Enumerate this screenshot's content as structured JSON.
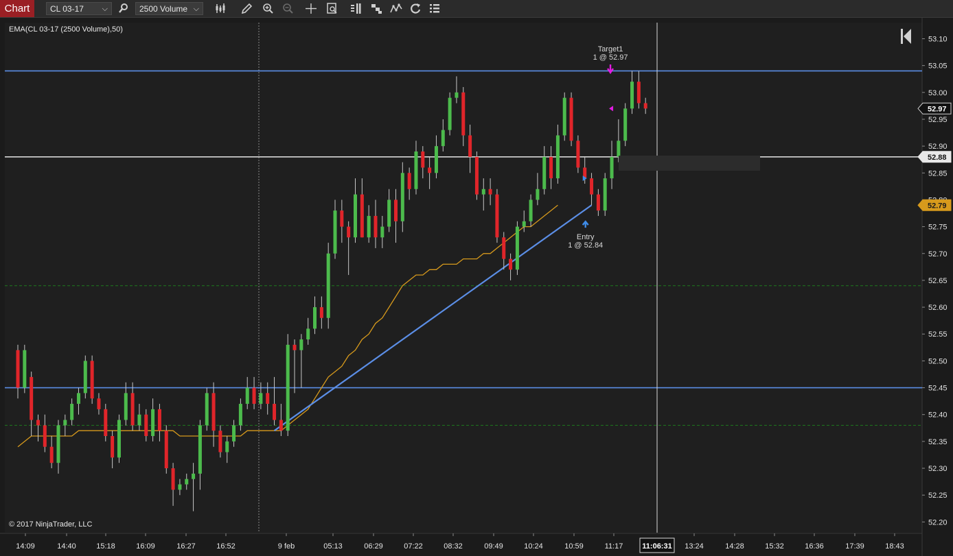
{
  "toolbar": {
    "tab_label": "Chart",
    "instrument": "CL 03-17",
    "interval": "2500 Volume",
    "icons": [
      "search-icon",
      "bars-type-icon",
      "pencil-icon",
      "zoom-in-icon",
      "zoom-out-icon",
      "crosshair-icon",
      "data-box-icon",
      "chart-trader-icon",
      "strategies-icon",
      "indicators-icon",
      "refresh-icon",
      "properties-icon"
    ]
  },
  "indicator_label": "EMA(CL 03-17 (2500 Volume),50)",
  "copyright": "© 2017 NinjaTrader, LLC",
  "price_axis": {
    "ticks": [
      "53.10",
      "53.05",
      "53.00",
      "52.95",
      "52.90",
      "52.85",
      "52.80",
      "52.75",
      "52.70",
      "52.65",
      "52.60",
      "52.55",
      "52.50",
      "52.45",
      "52.40",
      "52.35",
      "52.30",
      "52.25",
      "52.20"
    ],
    "markers": [
      {
        "label": "52.97",
        "price": 52.97,
        "style": "last"
      },
      {
        "label": "52.88",
        "price": 52.88,
        "style": "cursor"
      },
      {
        "label": "52.79",
        "price": 52.79,
        "style": "ema"
      }
    ]
  },
  "time_axis": {
    "ticks": [
      "14:09",
      "14:40",
      "15:18",
      "16:09",
      "16:27",
      "16:52",
      "9 feb",
      "05:13",
      "06:29",
      "07:22",
      "08:32",
      "09:49",
      "10:24",
      "10:59",
      "11:17",
      "13:24",
      "14:28",
      "15:32",
      "16:36",
      "17:39",
      "18:43"
    ],
    "cursor_label": "11:06:31"
  },
  "chart_data": {
    "type": "candlestick",
    "instrument": "CL 03-17",
    "interval": "2500 Volume",
    "indicator": "EMA(CL 03-17 (2500 Volume),50)",
    "ylim": [
      52.18,
      53.13
    ],
    "candles": [
      [
        52.52,
        52.45,
        52.53,
        52.43
      ],
      [
        52.45,
        52.52,
        52.53,
        52.44
      ],
      [
        52.47,
        52.39,
        52.48,
        52.36
      ],
      [
        52.39,
        52.38,
        52.4,
        52.35
      ],
      [
        52.38,
        52.34,
        52.4,
        52.33
      ],
      [
        52.34,
        52.31,
        52.36,
        52.3
      ],
      [
        52.31,
        52.38,
        52.39,
        52.29
      ],
      [
        52.38,
        52.39,
        52.4,
        52.36
      ],
      [
        52.39,
        52.42,
        52.43,
        52.38
      ],
      [
        52.42,
        52.44,
        52.45,
        52.4
      ],
      [
        52.44,
        52.5,
        52.51,
        52.43
      ],
      [
        52.5,
        52.43,
        52.51,
        52.42
      ],
      [
        52.43,
        52.41,
        52.44,
        52.4
      ],
      [
        52.41,
        52.36,
        52.42,
        52.35
      ],
      [
        52.36,
        52.32,
        52.37,
        52.3
      ],
      [
        52.32,
        52.39,
        52.4,
        52.31
      ],
      [
        52.39,
        52.44,
        52.46,
        52.38
      ],
      [
        52.44,
        52.38,
        52.46,
        52.37
      ],
      [
        52.38,
        52.4,
        52.42,
        52.37
      ],
      [
        52.4,
        52.36,
        52.41,
        52.35
      ],
      [
        52.36,
        52.41,
        52.43,
        52.35
      ],
      [
        52.41,
        52.37,
        52.42,
        52.35
      ],
      [
        52.37,
        52.3,
        52.38,
        52.29
      ],
      [
        52.3,
        52.26,
        52.31,
        52.23
      ],
      [
        52.26,
        52.27,
        52.28,
        52.25
      ],
      [
        52.27,
        52.28,
        52.29,
        52.26
      ],
      [
        52.28,
        52.29,
        52.31,
        52.22
      ],
      [
        52.29,
        52.38,
        52.39,
        52.26
      ],
      [
        52.38,
        52.44,
        52.45,
        52.37
      ],
      [
        52.44,
        52.37,
        52.46,
        52.34
      ],
      [
        52.37,
        52.33,
        52.38,
        52.32
      ],
      [
        52.33,
        52.35,
        52.36,
        52.31
      ],
      [
        52.35,
        52.38,
        52.39,
        52.34
      ],
      [
        52.38,
        52.42,
        52.43,
        52.37
      ],
      [
        52.42,
        52.45,
        52.47,
        52.41
      ],
      [
        52.45,
        52.42,
        52.47,
        52.41
      ],
      [
        52.42,
        52.44,
        52.46,
        52.41
      ],
      [
        52.44,
        52.42,
        52.46,
        52.4
      ],
      [
        52.42,
        52.39,
        52.47,
        52.38
      ],
      [
        52.39,
        52.37,
        52.42,
        52.36
      ],
      [
        52.37,
        52.53,
        52.55,
        52.36
      ],
      [
        52.53,
        52.52,
        52.54,
        52.44
      ],
      [
        52.52,
        52.54,
        52.55,
        52.45
      ],
      [
        52.54,
        52.56,
        52.58,
        52.53
      ],
      [
        52.56,
        52.6,
        52.62,
        52.55
      ],
      [
        52.6,
        52.58,
        52.62,
        52.56
      ],
      [
        52.58,
        52.7,
        52.72,
        52.56
      ],
      [
        52.7,
        52.78,
        52.8,
        52.69
      ],
      [
        52.78,
        52.75,
        52.8,
        52.72
      ],
      [
        52.75,
        52.73,
        52.76,
        52.66
      ],
      [
        52.73,
        52.81,
        52.84,
        52.72
      ],
      [
        52.81,
        52.73,
        52.84,
        52.73
      ],
      [
        52.73,
        52.77,
        52.79,
        52.72
      ],
      [
        52.77,
        52.73,
        52.8,
        52.71
      ],
      [
        52.73,
        52.75,
        52.77,
        52.71
      ],
      [
        52.75,
        52.8,
        52.82,
        52.74
      ],
      [
        52.8,
        52.76,
        52.82,
        52.72
      ],
      [
        52.76,
        52.85,
        52.87,
        52.74
      ],
      [
        52.85,
        52.82,
        52.86,
        52.8
      ],
      [
        52.82,
        52.89,
        52.91,
        52.81
      ],
      [
        52.89,
        52.86,
        52.9,
        52.84
      ],
      [
        52.86,
        52.85,
        52.88,
        52.82
      ],
      [
        52.85,
        52.9,
        52.92,
        52.84
      ],
      [
        52.9,
        52.93,
        52.95,
        52.89
      ],
      [
        52.93,
        52.99,
        53.0,
        52.92
      ],
      [
        52.99,
        53.0,
        53.03,
        52.98
      ],
      [
        53.0,
        52.92,
        53.01,
        52.9
      ],
      [
        52.92,
        52.88,
        52.94,
        52.85
      ],
      [
        52.88,
        52.81,
        52.89,
        52.8
      ],
      [
        52.81,
        52.82,
        52.84,
        52.78
      ],
      [
        52.82,
        52.81,
        52.84,
        52.79
      ],
      [
        52.81,
        52.73,
        52.82,
        52.72
      ],
      [
        52.73,
        52.69,
        52.74,
        52.67
      ],
      [
        52.69,
        52.67,
        52.7,
        52.65
      ],
      [
        52.67,
        52.75,
        52.76,
        52.66
      ],
      [
        52.75,
        52.76,
        52.78,
        52.74
      ],
      [
        52.76,
        52.8,
        52.81,
        52.75
      ],
      [
        52.8,
        52.82,
        52.85,
        52.79
      ],
      [
        52.82,
        52.88,
        52.9,
        52.81
      ],
      [
        52.88,
        52.84,
        52.9,
        52.82
      ],
      [
        52.84,
        52.92,
        52.94,
        52.83
      ],
      [
        52.92,
        52.99,
        53.0,
        52.91
      ],
      [
        52.99,
        52.91,
        53.0,
        52.9
      ],
      [
        52.91,
        52.86,
        52.92,
        52.85
      ],
      [
        52.86,
        52.84,
        52.88,
        52.83
      ],
      [
        52.84,
        52.81,
        52.85,
        52.79
      ],
      [
        52.81,
        52.78,
        52.82,
        52.77
      ],
      [
        52.78,
        52.84,
        52.85,
        52.77
      ],
      [
        52.84,
        52.88,
        52.91,
        52.82
      ],
      [
        52.88,
        52.91,
        52.95,
        52.87
      ],
      [
        52.91,
        52.97,
        52.98,
        52.9
      ],
      [
        52.97,
        53.02,
        53.04,
        52.96
      ],
      [
        53.02,
        52.98,
        53.04,
        52.97
      ],
      [
        52.98,
        52.97,
        52.99,
        52.96
      ]
    ],
    "ema": [
      52.34,
      52.35,
      52.36,
      52.36,
      52.36,
      52.36,
      52.36,
      52.36,
      52.36,
      52.37,
      52.37,
      52.37,
      52.37,
      52.37,
      52.37,
      52.37,
      52.37,
      52.37,
      52.37,
      52.37,
      52.37,
      52.37,
      52.37,
      52.37,
      52.36,
      52.36,
      52.36,
      52.36,
      52.36,
      52.36,
      52.36,
      52.36,
      52.36,
      52.36,
      52.37,
      52.37,
      52.37,
      52.37,
      52.37,
      52.37,
      52.38,
      52.39,
      52.4,
      52.41,
      52.43,
      52.45,
      52.47,
      52.48,
      52.49,
      52.51,
      52.52,
      52.54,
      52.55,
      52.57,
      52.58,
      52.6,
      52.62,
      52.64,
      52.65,
      52.66,
      52.66,
      52.67,
      52.67,
      52.68,
      52.68,
      52.68,
      52.69,
      52.69,
      52.69,
      52.7,
      52.7,
      52.71,
      52.72,
      52.73,
      52.74,
      52.75,
      52.75,
      52.76,
      52.77,
      52.78,
      52.79
    ],
    "horizontal_lines": [
      {
        "price": 53.04,
        "color": "#5b8ee6",
        "style": "solid"
      },
      {
        "price": 52.45,
        "color": "#5b8ee6",
        "style": "solid"
      },
      {
        "price": 52.88,
        "color": "#d8d8d8",
        "style": "solid"
      },
      {
        "price": 52.64,
        "color": "#1f7a1f",
        "style": "dashed"
      },
      {
        "price": 52.38,
        "color": "#1f7a1f",
        "style": "dashed"
      }
    ],
    "trend_line": {
      "from_bar": 38,
      "from_price": 52.37,
      "to_bar": 85,
      "to_price": 52.79
    },
    "entry": {
      "title": "Entry",
      "detail": "1 @ 52.84",
      "bar": 84,
      "price": 52.84
    },
    "target": {
      "title": "Target1",
      "detail": "1 @ 52.97",
      "bar": 88,
      "price": 52.97
    },
    "colors": {
      "up": "#4cbb4c",
      "down": "#e0252a",
      "wick": "#c8c8c8",
      "ema": "#d79a1c",
      "grid": "#2a2a2a",
      "axis_text": "#e4e4e4"
    }
  }
}
